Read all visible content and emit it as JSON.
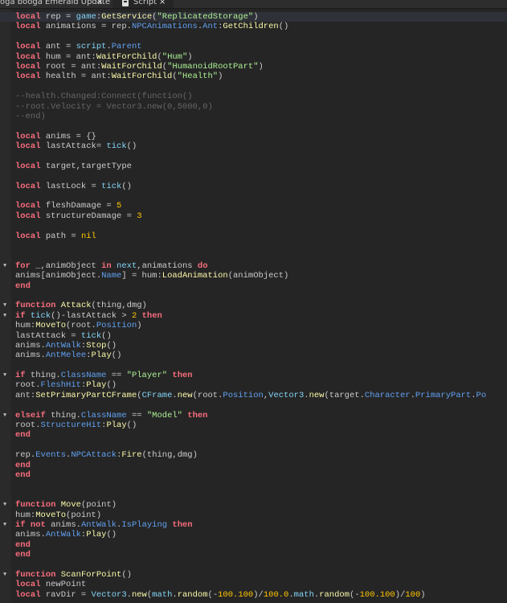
{
  "tabs": [
    {
      "label": "oga booga Emerald Update",
      "close": "×"
    },
    {
      "label": "Script",
      "close": "×",
      "icon": "script-doc-icon",
      "active": true
    }
  ],
  "colors": {
    "keyword": "#f86d7c",
    "function": "#fdfbac",
    "property": "#61a1f1",
    "string": "#adf195",
    "number": "#ffc600",
    "comment": "#666666",
    "text": "#cccccc",
    "builtin": "#84d6f7"
  },
  "current_line": 1,
  "lines": [
    {
      "t": [
        [
          "k",
          "local"
        ],
        [
          "t",
          " rep = "
        ],
        [
          "b",
          "game"
        ],
        [
          "t",
          ":"
        ],
        [
          "f",
          "GetService"
        ],
        [
          "t",
          "("
        ],
        [
          "s",
          "\"ReplicatedStorage\""
        ],
        [
          "t",
          ")"
        ]
      ]
    },
    {
      "t": [
        [
          "k",
          "local"
        ],
        [
          "t",
          " animations = rep."
        ],
        [
          "p",
          "NPCAnimations"
        ],
        [
          "t",
          "."
        ],
        [
          "p",
          "Ant"
        ],
        [
          "t",
          ":"
        ],
        [
          "f",
          "GetChildren"
        ],
        [
          "t",
          "()"
        ]
      ]
    },
    {
      "t": []
    },
    {
      "t": [
        [
          "k",
          "local"
        ],
        [
          "t",
          " ant = "
        ],
        [
          "b",
          "script"
        ],
        [
          "t",
          "."
        ],
        [
          "p",
          "Parent"
        ]
      ]
    },
    {
      "t": [
        [
          "k",
          "local"
        ],
        [
          "t",
          " hum = ant:"
        ],
        [
          "f",
          "WaitForChild"
        ],
        [
          "t",
          "("
        ],
        [
          "s",
          "\"Hum\""
        ],
        [
          "t",
          ")"
        ]
      ]
    },
    {
      "t": [
        [
          "k",
          "local"
        ],
        [
          "t",
          " root = ant:"
        ],
        [
          "f",
          "WaitForChild"
        ],
        [
          "t",
          "("
        ],
        [
          "s",
          "\"HumanoidRootPart\""
        ],
        [
          "t",
          ")"
        ]
      ]
    },
    {
      "t": [
        [
          "k",
          "local"
        ],
        [
          "t",
          " health = ant:"
        ],
        [
          "f",
          "WaitForChild"
        ],
        [
          "t",
          "("
        ],
        [
          "s",
          "\"Health\""
        ],
        [
          "t",
          ")"
        ]
      ]
    },
    {
      "t": []
    },
    {
      "t": [
        [
          "c",
          "--health.Changed:Connect(function()"
        ]
      ]
    },
    {
      "t": [
        [
          "c",
          "--root.Velocity = Vector3.new(0,5000,0)"
        ]
      ]
    },
    {
      "t": [
        [
          "c",
          "--end)"
        ]
      ]
    },
    {
      "t": []
    },
    {
      "t": [
        [
          "k",
          "local"
        ],
        [
          "t",
          " anims = {}"
        ]
      ]
    },
    {
      "t": [
        [
          "k",
          "local"
        ],
        [
          "t",
          " lastAttack= "
        ],
        [
          "b",
          "tick"
        ],
        [
          "t",
          "()"
        ]
      ]
    },
    {
      "t": []
    },
    {
      "t": [
        [
          "k",
          "local"
        ],
        [
          "t",
          " target,targetType"
        ]
      ]
    },
    {
      "t": []
    },
    {
      "t": [
        [
          "k",
          "local"
        ],
        [
          "t",
          " lastLock = "
        ],
        [
          "b",
          "tick"
        ],
        [
          "t",
          "()"
        ]
      ]
    },
    {
      "t": []
    },
    {
      "t": [
        [
          "k",
          "local"
        ],
        [
          "t",
          " fleshDamage = "
        ],
        [
          "n",
          "5"
        ]
      ]
    },
    {
      "t": [
        [
          "k",
          "local"
        ],
        [
          "t",
          " structureDamage = "
        ],
        [
          "n",
          "3"
        ]
      ]
    },
    {
      "t": []
    },
    {
      "t": [
        [
          "k",
          "local"
        ],
        [
          "t",
          " path = "
        ],
        [
          "n",
          "nil"
        ]
      ]
    },
    {
      "t": []
    },
    {
      "t": []
    },
    {
      "fold": true,
      "t": [
        [
          "k",
          "for"
        ],
        [
          "t",
          " _,animObject "
        ],
        [
          "k",
          "in"
        ],
        [
          "t",
          " "
        ],
        [
          "b",
          "next"
        ],
        [
          "t",
          ",animations "
        ],
        [
          "k",
          "do"
        ]
      ]
    },
    {
      "t": [
        [
          "t",
          "anims[animObject."
        ],
        [
          "p",
          "Name"
        ],
        [
          "t",
          "] = hum:"
        ],
        [
          "f",
          "LoadAnimation"
        ],
        [
          "t",
          "(animObject)"
        ]
      ]
    },
    {
      "t": [
        [
          "k",
          "end"
        ]
      ]
    },
    {
      "t": []
    },
    {
      "fold": true,
      "t": [
        [
          "k",
          "function"
        ],
        [
          "t",
          " "
        ],
        [
          "f",
          "Attack"
        ],
        [
          "t",
          "(thing,dmg)"
        ]
      ]
    },
    {
      "fold": true,
      "t": [
        [
          "k",
          "if"
        ],
        [
          "t",
          " "
        ],
        [
          "b",
          "tick"
        ],
        [
          "t",
          "()-lastAttack > "
        ],
        [
          "n",
          "2"
        ],
        [
          "t",
          " "
        ],
        [
          "k",
          "then"
        ]
      ]
    },
    {
      "t": [
        [
          "t",
          "hum:"
        ],
        [
          "f",
          "MoveTo"
        ],
        [
          "t",
          "(root."
        ],
        [
          "p",
          "Position"
        ],
        [
          "t",
          ")"
        ]
      ]
    },
    {
      "t": [
        [
          "t",
          "lastAttack = "
        ],
        [
          "b",
          "tick"
        ],
        [
          "t",
          "()"
        ]
      ]
    },
    {
      "t": [
        [
          "t",
          "anims."
        ],
        [
          "p",
          "AntWalk"
        ],
        [
          "t",
          ":"
        ],
        [
          "f",
          "Stop"
        ],
        [
          "t",
          "()"
        ]
      ]
    },
    {
      "t": [
        [
          "t",
          "anims."
        ],
        [
          "p",
          "AntMelee"
        ],
        [
          "t",
          ":"
        ],
        [
          "f",
          "Play"
        ],
        [
          "t",
          "()"
        ]
      ]
    },
    {
      "t": []
    },
    {
      "fold": true,
      "t": [
        [
          "k",
          "if"
        ],
        [
          "t",
          " thing."
        ],
        [
          "p",
          "ClassName"
        ],
        [
          "t",
          " == "
        ],
        [
          "s",
          "\"Player\""
        ],
        [
          "t",
          " "
        ],
        [
          "k",
          "then"
        ]
      ]
    },
    {
      "t": [
        [
          "t",
          "root."
        ],
        [
          "p",
          "FleshHit"
        ],
        [
          "t",
          ":"
        ],
        [
          "f",
          "Play"
        ],
        [
          "t",
          "()"
        ]
      ]
    },
    {
      "t": [
        [
          "t",
          "ant:"
        ],
        [
          "f",
          "SetPrimaryPartCFrame"
        ],
        [
          "t",
          "("
        ],
        [
          "b",
          "CFrame"
        ],
        [
          "t",
          "."
        ],
        [
          "f",
          "new"
        ],
        [
          "t",
          "(root."
        ],
        [
          "p",
          "Position"
        ],
        [
          "t",
          ","
        ],
        [
          "b",
          "Vector3"
        ],
        [
          "t",
          "."
        ],
        [
          "f",
          "new"
        ],
        [
          "t",
          "(target."
        ],
        [
          "p",
          "Character"
        ],
        [
          "t",
          "."
        ],
        [
          "p",
          "PrimaryPart"
        ],
        [
          "t",
          "."
        ],
        [
          "p",
          "Po"
        ]
      ]
    },
    {
      "t": []
    },
    {
      "fold": true,
      "t": [
        [
          "k",
          "elseif"
        ],
        [
          "t",
          " thing."
        ],
        [
          "p",
          "ClassName"
        ],
        [
          "t",
          " == "
        ],
        [
          "s",
          "\"Model\""
        ],
        [
          "t",
          " "
        ],
        [
          "k",
          "then"
        ]
      ]
    },
    {
      "t": [
        [
          "t",
          "root."
        ],
        [
          "p",
          "StructureHit"
        ],
        [
          "t",
          ":"
        ],
        [
          "f",
          "Play"
        ],
        [
          "t",
          "()"
        ]
      ]
    },
    {
      "t": [
        [
          "k",
          "end"
        ]
      ]
    },
    {
      "t": []
    },
    {
      "t": [
        [
          "t",
          "rep."
        ],
        [
          "p",
          "Events"
        ],
        [
          "t",
          "."
        ],
        [
          "p",
          "NPCAttack"
        ],
        [
          "t",
          ":"
        ],
        [
          "f",
          "Fire"
        ],
        [
          "t",
          "(thing,dmg)"
        ]
      ]
    },
    {
      "t": [
        [
          "k",
          "end"
        ]
      ]
    },
    {
      "t": [
        [
          "k",
          "end"
        ]
      ]
    },
    {
      "t": []
    },
    {
      "t": []
    },
    {
      "fold": true,
      "t": [
        [
          "k",
          "function"
        ],
        [
          "t",
          " "
        ],
        [
          "f",
          "Move"
        ],
        [
          "t",
          "(point)"
        ]
      ]
    },
    {
      "t": [
        [
          "t",
          "hum:"
        ],
        [
          "f",
          "MoveTo"
        ],
        [
          "t",
          "(point)"
        ]
      ]
    },
    {
      "fold": true,
      "t": [
        [
          "k",
          "if"
        ],
        [
          "t",
          " "
        ],
        [
          "k",
          "not"
        ],
        [
          "t",
          " anims."
        ],
        [
          "p",
          "AntWalk"
        ],
        [
          "t",
          "."
        ],
        [
          "p",
          "IsPlaying"
        ],
        [
          "t",
          " "
        ],
        [
          "k",
          "then"
        ]
      ]
    },
    {
      "t": [
        [
          "t",
          "anims."
        ],
        [
          "p",
          "AntWalk"
        ],
        [
          "t",
          ":"
        ],
        [
          "f",
          "Play"
        ],
        [
          "t",
          "()"
        ]
      ]
    },
    {
      "t": [
        [
          "k",
          "end"
        ]
      ]
    },
    {
      "t": [
        [
          "k",
          "end"
        ]
      ]
    },
    {
      "t": []
    },
    {
      "fold": true,
      "t": [
        [
          "k",
          "function"
        ],
        [
          "t",
          " "
        ],
        [
          "f",
          "ScanForPoint"
        ],
        [
          "t",
          "()"
        ]
      ]
    },
    {
      "t": [
        [
          "k",
          "local"
        ],
        [
          "t",
          " newPoint"
        ]
      ]
    },
    {
      "t": [
        [
          "k",
          "local"
        ],
        [
          "t",
          " ravDir = "
        ],
        [
          "b",
          "Vector3"
        ],
        [
          "t",
          "."
        ],
        [
          "f",
          "new"
        ],
        [
          "t",
          "("
        ],
        [
          "b",
          "math"
        ],
        [
          "t",
          "."
        ],
        [
          "f",
          "random"
        ],
        [
          "t",
          "(-"
        ],
        [
          "n",
          "100.100"
        ],
        [
          "t",
          ")/"
        ],
        [
          "n",
          "100.0"
        ],
        [
          "t",
          "."
        ],
        [
          "b",
          "math"
        ],
        [
          "t",
          "."
        ],
        [
          "f",
          "random"
        ],
        [
          "t",
          "(-"
        ],
        [
          "n",
          "100.100"
        ],
        [
          "t",
          ")/"
        ],
        [
          "n",
          "100"
        ],
        [
          "t",
          ")"
        ]
      ]
    }
  ]
}
